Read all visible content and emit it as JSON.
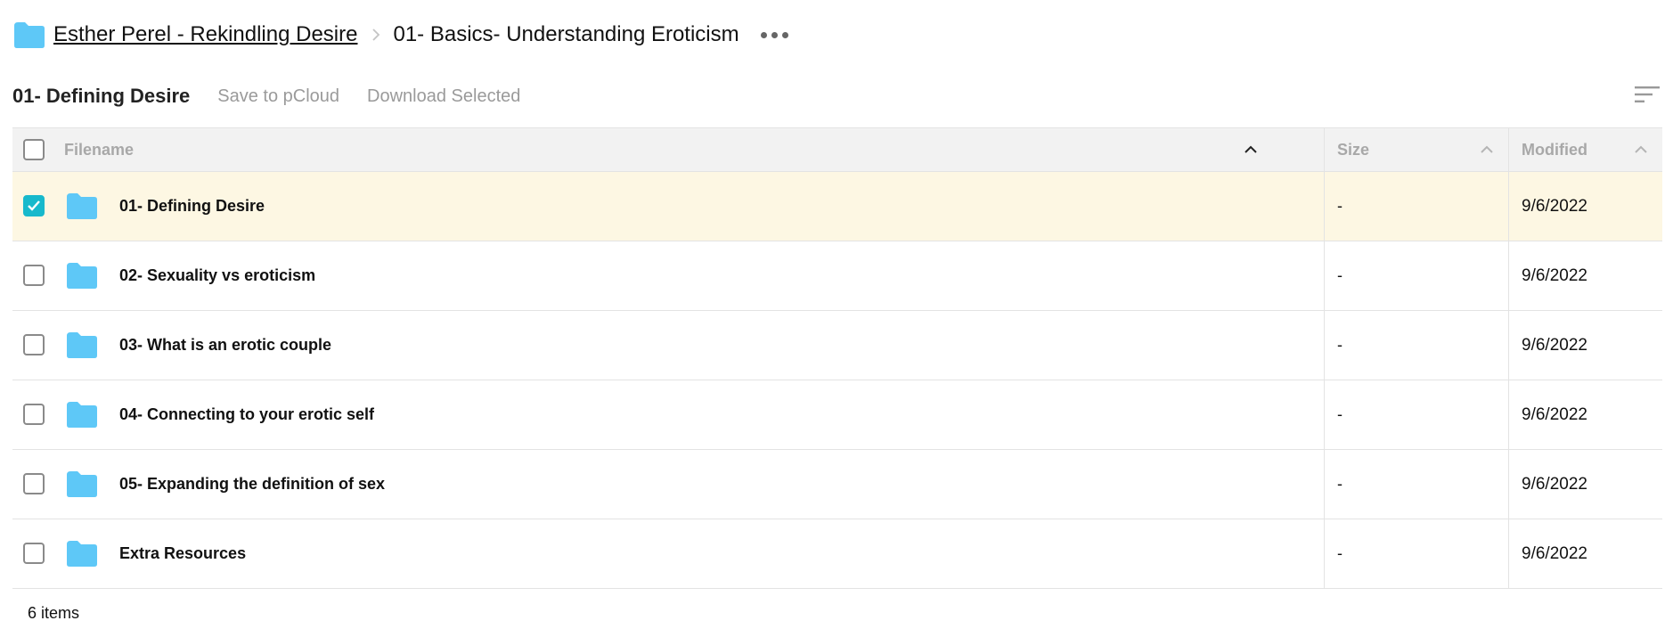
{
  "breadcrumb": {
    "root": "Esther Perel - Rekindling Desire",
    "current": "01- Basics- Understanding Eroticism"
  },
  "toolbar": {
    "title": "01- Defining Desire",
    "save_label": "Save to pCloud",
    "download_label": "Download Selected"
  },
  "table": {
    "headers": {
      "name": "Filename",
      "size": "Size",
      "modified": "Modified"
    },
    "rows": [
      {
        "name": "01- Defining Desire",
        "size": "-",
        "modified": "9/6/2022",
        "selected": true
      },
      {
        "name": "02- Sexuality vs eroticism",
        "size": "-",
        "modified": "9/6/2022",
        "selected": false
      },
      {
        "name": "03- What is an erotic couple",
        "size": "-",
        "modified": "9/6/2022",
        "selected": false
      },
      {
        "name": "04- Connecting to your erotic self",
        "size": "-",
        "modified": "9/6/2022",
        "selected": false
      },
      {
        "name": "05- Expanding the definition of sex",
        "size": "-",
        "modified": "9/6/2022",
        "selected": false
      },
      {
        "name": "Extra Resources",
        "size": "-",
        "modified": "9/6/2022",
        "selected": false
      }
    ]
  },
  "footer": {
    "count": "6 items"
  },
  "colors": {
    "folder": "#5ec8f7",
    "accent": "#17b9cc",
    "selected_row": "#fdf7e3"
  }
}
